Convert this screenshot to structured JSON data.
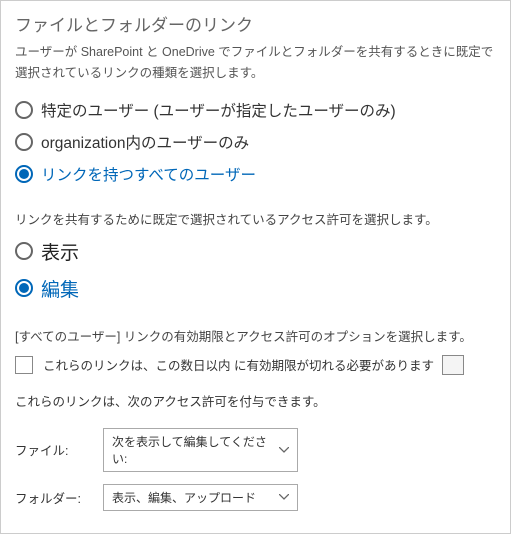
{
  "title": "ファイルとフォルダーのリンク",
  "description": "ユーザーが SharePoint と OneDrive でファイルとフォルダーを共有するときに既定で選択されているリンクの種類を選択します。",
  "linkTypes": [
    {
      "label": "特定のユーザー (ユーザーが指定したユーザーのみ)",
      "selected": false
    },
    {
      "label": "organization内のユーザーのみ",
      "selected": false
    },
    {
      "label": "リンクを持つすべてのユーザー",
      "selected": true
    }
  ],
  "permDescription": "リンクを共有するために既定で選択されているアクセス許可を選択します。",
  "perms": [
    {
      "label": "表示",
      "selected": false
    },
    {
      "label": "編集",
      "selected": true
    }
  ],
  "optionsDescription": "[すべてのユーザー] リンクの有効期限とアクセス許可のオプションを選択します。",
  "expiry": {
    "checked": false,
    "label_pre": "これらのリンクは、この数日以内 に有効期限が切れる必要があります"
  },
  "grantInfo": "これらのリンクは、次のアクセス許可を付与できます。",
  "fileRow": {
    "label": "ファイル:",
    "value": "次を表示して編集してください:"
  },
  "folderRow": {
    "label": "フォルダー:",
    "value": "表示、編集、アップロード"
  }
}
